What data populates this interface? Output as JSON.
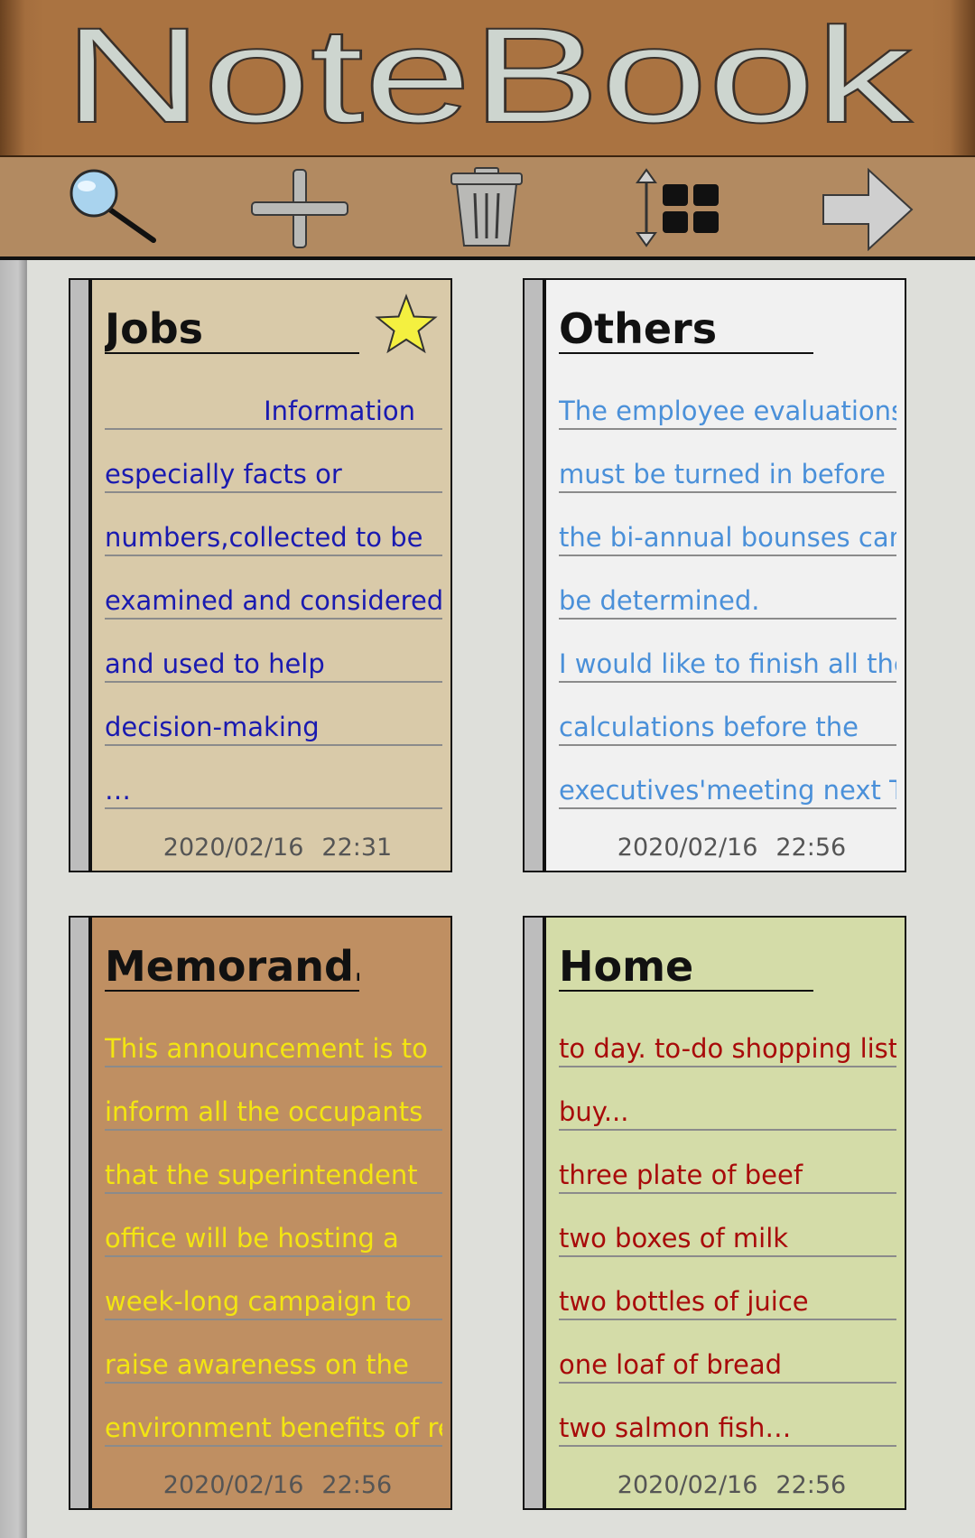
{
  "app": {
    "title": "NoteBook"
  },
  "toolbar": {
    "buttons": [
      {
        "name": "search-button",
        "icon": "magnifier-icon"
      },
      {
        "name": "add-note-button",
        "icon": "plus-icon"
      },
      {
        "name": "delete-button",
        "icon": "trash-icon"
      },
      {
        "name": "sort-view-button",
        "icon": "grid-sort-icon"
      },
      {
        "name": "next-button",
        "icon": "arrow-right-icon"
      }
    ]
  },
  "notes": [
    {
      "title": "Jobs",
      "starred": true,
      "bg_color": "#d9caa9",
      "text_color": "#1a1ab0",
      "lines": [
        "Information",
        "especially facts or",
        "numbers,collected to be",
        "examined and considered",
        "and used to help",
        "decision-making",
        "…"
      ],
      "date": "2020/02/16",
      "time": "22:31"
    },
    {
      "title": "Others",
      "starred": false,
      "bg_color": "#f1f1f1",
      "text_color": "#4a90d9",
      "lines": [
        "The employee evaluations",
        "must be turned in before",
        "the bi-annual bounses can",
        "be determined.",
        "I would like to finish all the",
        "calculations before the",
        "executives'meeting next T…"
      ],
      "date": "2020/02/16",
      "time": "22:56"
    },
    {
      "title": "Memorand…",
      "starred": false,
      "bg_color": "#bf8f62",
      "text_color": "#f3e512",
      "lines": [
        "This announcement is to",
        "inform all the occupants",
        "that the superintendent",
        "office will be hosting a",
        "week-long campaign to",
        "raise awareness on the",
        "environment benefits of re…"
      ],
      "date": "2020/02/16",
      "time": "22:56"
    },
    {
      "title": "Home",
      "starred": false,
      "bg_color": "#d4dca8",
      "text_color": "#a80a0a",
      "lines": [
        "to day.  to-do shopping list",
        "buy...",
        "three plate of beef",
        "two boxes of milk",
        "two bottles of juice",
        "one loaf of bread",
        "two salmon fish…"
      ],
      "date": "2020/02/16",
      "time": "22:56"
    }
  ]
}
